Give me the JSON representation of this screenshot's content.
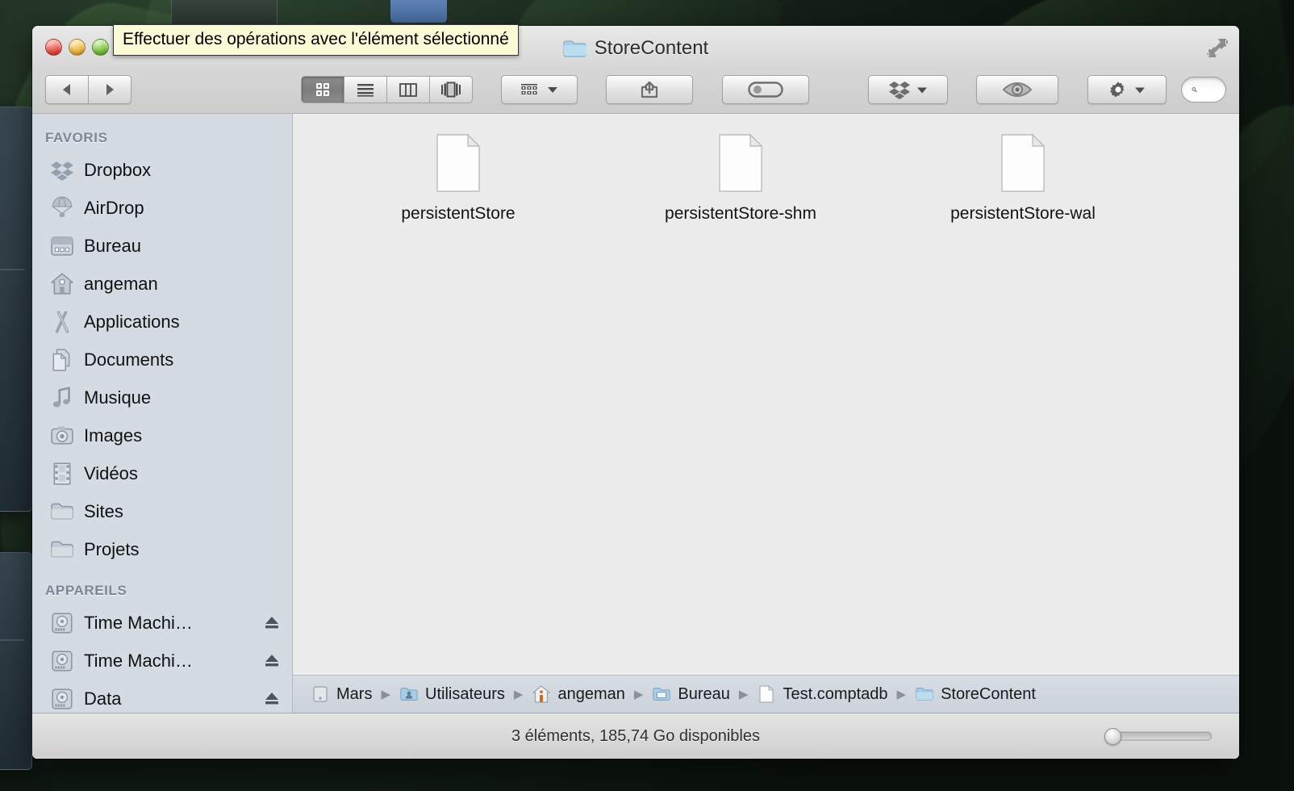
{
  "window": {
    "title": "StoreContent",
    "title_icon": "folder-icon",
    "traffic_lights": [
      "close-button",
      "minimize-button",
      "zoom-button"
    ],
    "fullscreen_icon": "fullscreen-arrows-icon"
  },
  "tooltip": {
    "text": "Effectuer des opérations avec l'élément sélectionné"
  },
  "toolbar": {
    "back_icon": "back-arrow-icon",
    "forward_icon": "forward-arrow-icon",
    "view_modes": [
      {
        "name": "icon-view",
        "icon": "grid-icon",
        "active": true
      },
      {
        "name": "list-view",
        "icon": "list-lines-icon",
        "active": false
      },
      {
        "name": "column-view",
        "icon": "columns-icon",
        "active": false
      },
      {
        "name": "coverflow-view",
        "icon": "coverflow-icon",
        "active": false
      }
    ],
    "arrange": {
      "name": "arrange-button",
      "icon": "grid-rows-icon",
      "has_menu": true
    },
    "share": {
      "name": "share-button",
      "icon": "share-arrow-icon"
    },
    "action_toggle": {
      "name": "edit-tags-button",
      "icon": "toggle-pill-icon"
    },
    "dropbox": {
      "name": "dropbox-button",
      "icon": "dropbox-icon",
      "has_menu": true
    },
    "quicklook": {
      "name": "quick-look-button",
      "icon": "eye-icon"
    },
    "gear": {
      "name": "action-menu-button",
      "icon": "gear-icon",
      "has_menu": true
    },
    "search": {
      "icon": "search-icon",
      "value": "",
      "placeholder": ""
    }
  },
  "sidebar": {
    "sections": [
      {
        "header": "FAVORIS",
        "items": [
          {
            "label": "Dropbox",
            "icon": "dropbox-icon"
          },
          {
            "label": "AirDrop",
            "icon": "airdrop-parachute-icon"
          },
          {
            "label": "Bureau",
            "icon": "desktop-icon"
          },
          {
            "label": "angeman",
            "icon": "home-house-icon"
          },
          {
            "label": "Applications",
            "icon": "applications-icon"
          },
          {
            "label": "Documents",
            "icon": "documents-icon"
          },
          {
            "label": "Musique",
            "icon": "music-note-icon"
          },
          {
            "label": "Images",
            "icon": "camera-icon"
          },
          {
            "label": "Vidéos",
            "icon": "film-strip-icon"
          },
          {
            "label": "Sites",
            "icon": "folder-icon"
          },
          {
            "label": "Projets",
            "icon": "folder-icon"
          }
        ]
      },
      {
        "header": "APPAREILS",
        "items": [
          {
            "label": "Time Machi…",
            "icon": "hard-drive-icon",
            "eject": true
          },
          {
            "label": "Time Machi…",
            "icon": "hard-drive-icon",
            "eject": true
          },
          {
            "label": "Data",
            "icon": "hard-drive-icon",
            "eject": true
          }
        ]
      }
    ]
  },
  "files": [
    {
      "name": "persistentStore",
      "icon": "blank-document-icon"
    },
    {
      "name": "persistentStore-shm",
      "icon": "blank-document-icon"
    },
    {
      "name": "persistentStore-wal",
      "icon": "blank-document-icon"
    }
  ],
  "pathbar": {
    "crumbs": [
      {
        "label": "Mars",
        "icon": "hard-drive-icon"
      },
      {
        "label": "Utilisateurs",
        "icon": "users-folder-icon"
      },
      {
        "label": "angeman",
        "icon": "home-house-icon"
      },
      {
        "label": "Bureau",
        "icon": "desktop-folder-icon"
      },
      {
        "label": "Test.comptadb",
        "icon": "blank-document-icon"
      },
      {
        "label": "StoreContent",
        "icon": "folder-icon"
      }
    ],
    "separator": "▶"
  },
  "statusbar": {
    "text": "3 éléments, 185,74 Go disponibles",
    "zoom_slider_value": 0
  },
  "colors": {
    "sidebar_bg": "#d5dbe3",
    "content_bg": "#ececec",
    "tooltip_bg": "#fbfbd7",
    "folder_blue": "#a8cde4"
  }
}
